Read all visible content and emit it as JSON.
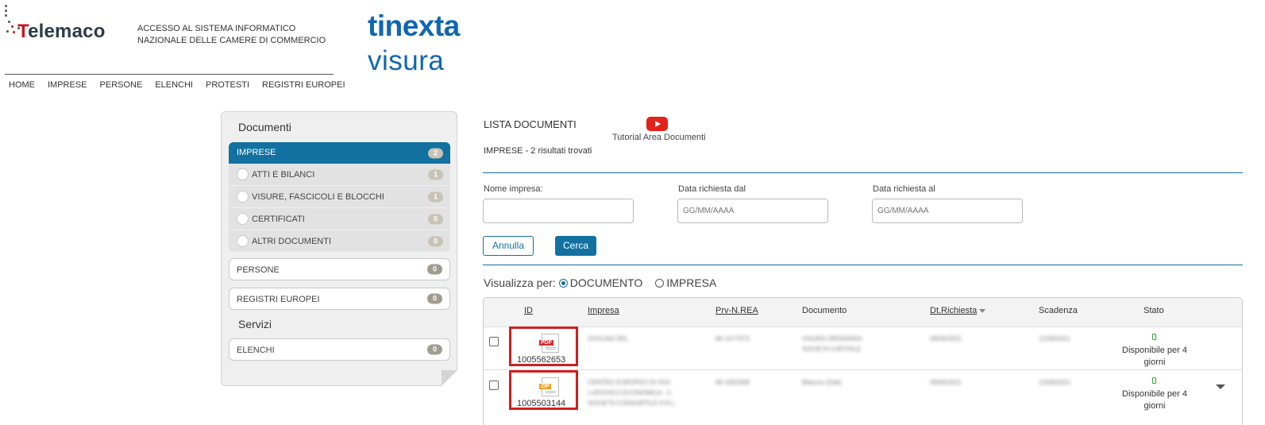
{
  "header": {
    "logo_dots_icon": "telemaco-dots-icon",
    "logo_text": "Telemaco",
    "tagline_line1": "ACCESSO AL SISTEMA INFORMATICO",
    "tagline_line2": "NAZIONALE DELLE CAMERE DI COMMERCIO",
    "brand_top": "tinexta",
    "brand_bottom": "visura",
    "brand_color": "#1166b3",
    "accent_red": "#c5161d"
  },
  "topnav": [
    "HOME",
    "IMPRESE",
    "PERSONE",
    "ELENCHI",
    "PROTESTI",
    "REGISTRI EUROPEI"
  ],
  "sidebar": {
    "heading_documenti": "Documenti",
    "active": {
      "label": "IMPRESE",
      "count": "2"
    },
    "sub_items": [
      {
        "label": "ATTI E BILANCI",
        "count": "1"
      },
      {
        "label": "VISURE, FASCICOLI E BLOCCHI",
        "count": "1"
      },
      {
        "label": "CERTIFICATI",
        "count": "0"
      },
      {
        "label": "ALTRI DOCUMENTI",
        "count": "0"
      }
    ],
    "persone": {
      "label": "PERSONE",
      "count": "0"
    },
    "registri": {
      "label": "REGISTRI EUROPEI",
      "count": "0"
    },
    "heading_servizi": "Servizi",
    "elenchi": {
      "label": "ELENCHI",
      "count": "0"
    }
  },
  "main": {
    "title": "LISTA DOCUMENTI",
    "tutorial_icon": "youtube-play-icon",
    "tutorial_label": "Tutorial Area Documenti",
    "result_count": "IMPRESE - 2 risultati trovati",
    "filters": {
      "nome_label": "Nome impresa:",
      "nome_value": "",
      "dal_label": "Data richiesta dal",
      "dal_placeholder": "GG/MM/AAAA",
      "al_label": "Data richiesta al",
      "al_placeholder": "GG/MM/AAAA"
    },
    "annulla_label": "Annulla",
    "cerca_label": "Cerca",
    "primary_color": "#1271a0",
    "visualizza_label": "Visualizza per:",
    "opt_documento": "DOCUMENTO",
    "opt_impresa": "IMPRESA",
    "selected_view": "DOCUMENTO"
  },
  "table": {
    "columns": [
      "ID",
      "Impresa",
      "Prv-N.REA",
      "Documento",
      "Dt.Richiesta",
      "Scadenza",
      "Stato"
    ],
    "rows": [
      {
        "file_type": "PDF",
        "file_color": "#d32a2a",
        "id": "1005562653",
        "impresa": "XXXLINA SRL",
        "rea": "MI-1477473",
        "documento": "VISURA ORDINARIA SOCIETA CAPITALE",
        "dt_richiesta": "09/06/2021",
        "scadenza": "12/06/2021",
        "stato": "Disponibile per 4 giorni"
      },
      {
        "file_type": "ZIP",
        "file_color": "#f0a020",
        "id": "1005503144",
        "impresa": "CENTRO EUROPEO DI XXX LUDOVICO ECONOMICA - C. SOCIETA CONSORTILE A R.L.",
        "rea": "MI-1902408",
        "documento": "Bilancio (Dati)",
        "dt_richiesta": "09/06/2021",
        "scadenza": "12/06/2021",
        "stato": "Disponibile per 4 giorni"
      }
    ]
  }
}
